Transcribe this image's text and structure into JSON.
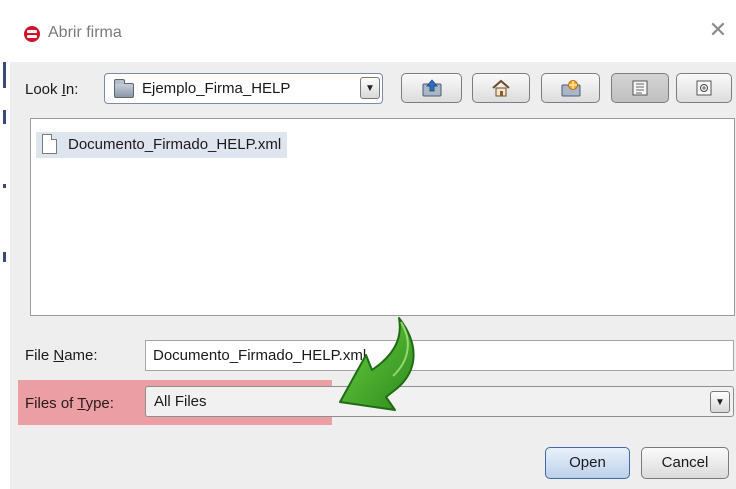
{
  "window": {
    "title": "Abrir firma",
    "close_icon": "close-icon"
  },
  "look_in": {
    "label": "Look In:",
    "value": "Ejemplo_Firma_HELP"
  },
  "toolbar": {
    "icons": [
      "up-folder-icon",
      "home-icon",
      "new-folder-icon",
      "list-view-icon",
      "details-view-icon"
    ]
  },
  "file_list": {
    "items": [
      {
        "name": "Documento_Firmado_HELP.xml",
        "icon": "document-icon"
      }
    ]
  },
  "file_name": {
    "label": "File Name:",
    "value": "Documento_Firmado_HELP.xml"
  },
  "file_type": {
    "label": "Files of Type:",
    "value": "All Files"
  },
  "buttons": {
    "open": "Open",
    "cancel": "Cancel"
  },
  "colors": {
    "highlight": "#e86e78",
    "annotation_arrow": "#3aa02a"
  }
}
